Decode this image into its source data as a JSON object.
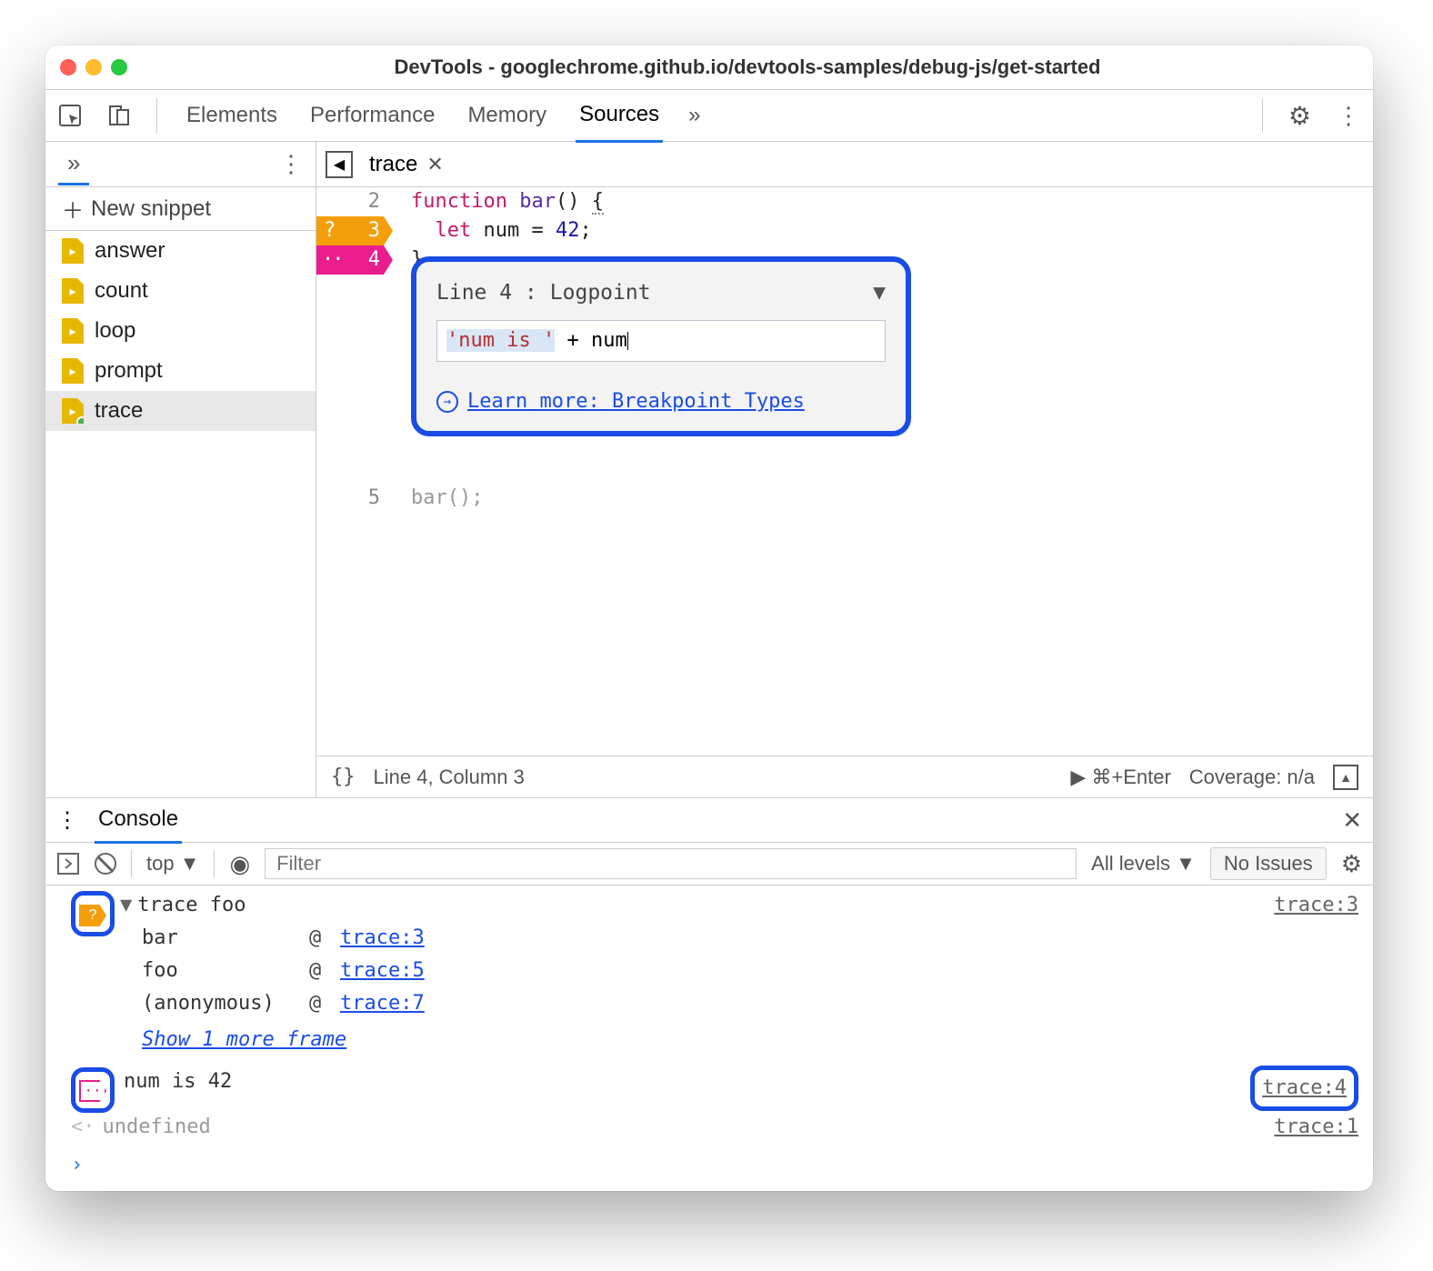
{
  "window": {
    "title": "DevTools - googlechrome.github.io/devtools-samples/debug-js/get-started"
  },
  "toolbar": {
    "tabs": [
      "Elements",
      "Performance",
      "Memory",
      "Sources"
    ],
    "active": "Sources",
    "more": "»"
  },
  "sidebar": {
    "overflow": "»",
    "newSnippet": "New snippet",
    "items": [
      {
        "label": "answer"
      },
      {
        "label": "count"
      },
      {
        "label": "loop"
      },
      {
        "label": "prompt"
      },
      {
        "label": "trace",
        "selected": true,
        "dirty": true
      }
    ]
  },
  "editor": {
    "tab": {
      "name": "trace"
    },
    "lines": [
      {
        "n": "2",
        "html": "function bar() {"
      },
      {
        "n": "3",
        "html": "  let num = 42;"
      },
      {
        "n": "4",
        "html": "}"
      },
      {
        "n": "5",
        "html": "bar();"
      }
    ],
    "popup": {
      "line_label": "Line 4 :",
      "type": "Logpoint",
      "expr": "'num is ' + num",
      "learn": "Learn more: Breakpoint Types"
    },
    "status": {
      "format_icon": "{}",
      "pos": "Line 4, Column 3",
      "run": "⌘+Enter",
      "coverage": "Coverage: n/a"
    }
  },
  "drawer": {
    "tab": "Console",
    "bar": {
      "context": "top",
      "filter_ph": "Filter",
      "levels": "All levels",
      "issues": "No Issues"
    },
    "log": {
      "trace_msg": "trace foo",
      "trace_src": "trace:3",
      "stack": [
        {
          "fn": "bar",
          "loc": "trace:3"
        },
        {
          "fn": "foo",
          "loc": "trace:5"
        },
        {
          "fn": "(anonymous)",
          "loc": "trace:7"
        }
      ],
      "show_more": "Show 1 more frame",
      "logpoint_msg": "num is 42",
      "logpoint_src": "trace:4",
      "undef": "undefined",
      "undef_src": "trace:1"
    }
  }
}
